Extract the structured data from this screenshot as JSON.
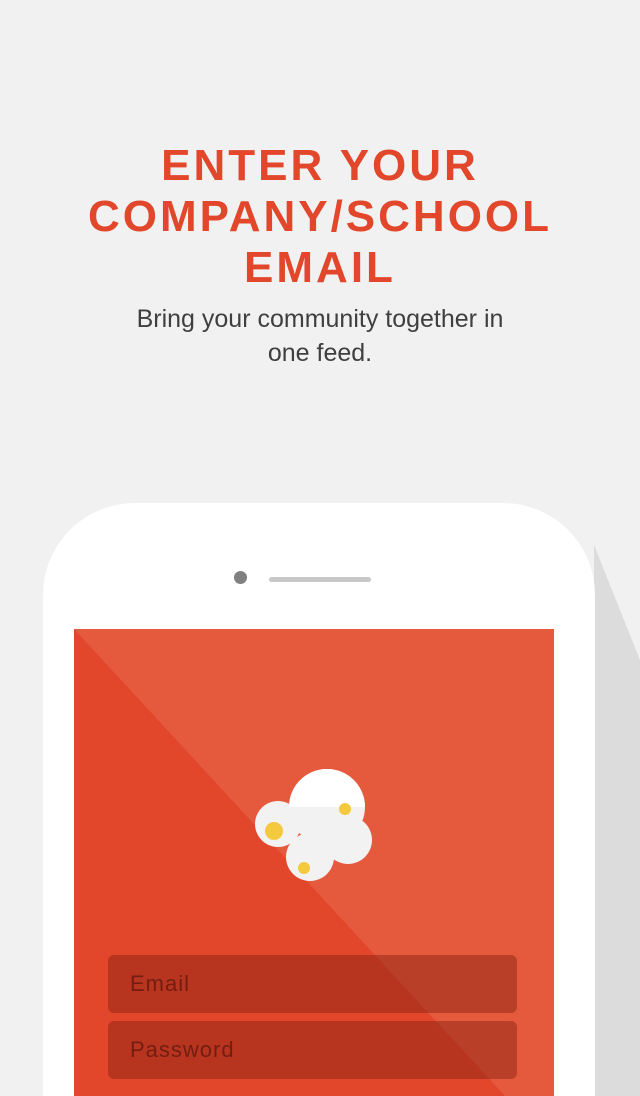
{
  "header": {
    "title_lines": [
      "ENTER YOUR",
      "COMPANY/SCHOOL",
      "EMAIL"
    ],
    "subtitle": "Bring your community together in one feed."
  },
  "phone": {
    "icons": {
      "logo": "bubbles-logo-icon",
      "camera": "camera-dot-icon",
      "speaker": "speaker-slot-icon"
    },
    "colors": {
      "accent": "#e2472b",
      "screen_light": "#e55a3c",
      "bubble": "#f2f2f2",
      "bubble_dot": "#f5c93e"
    },
    "form": {
      "email_placeholder": "Email",
      "password_placeholder": "Password"
    }
  }
}
